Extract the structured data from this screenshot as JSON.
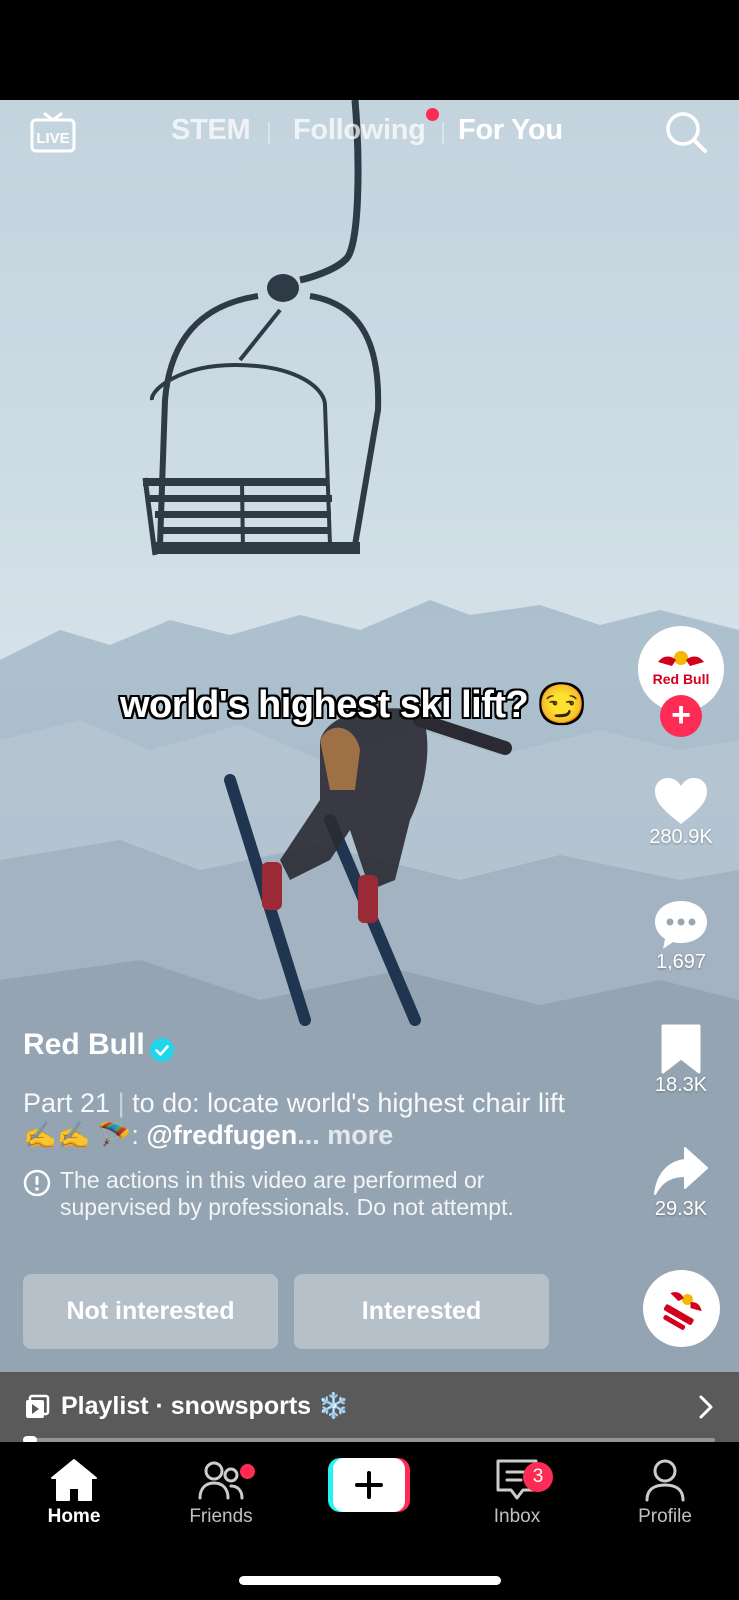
{
  "top_nav": {
    "live_label": "LIVE",
    "tabs": [
      {
        "label": "STEM",
        "active": false
      },
      {
        "label": "Following",
        "active": false,
        "has_dot": true
      },
      {
        "label": "For You",
        "active": true
      }
    ]
  },
  "video": {
    "caption": "world's highest ski lift? 😏"
  },
  "rail": {
    "avatar_brand": "Red Bull",
    "likes": "280.9K",
    "comments": "1,697",
    "saves": "18.3K",
    "shares": "29.3K"
  },
  "post": {
    "author": "Red Bull",
    "desc_part": "Part 21",
    "desc_text": "to do: locate world's highest chair lift ✍️✍️ 🪂:",
    "mention": "@fredfugen",
    "ellipsis": "...",
    "more": "more",
    "warning": "The actions in this video are performed or supervised by professionals. Do not attempt."
  },
  "buttons": {
    "not_interested": "Not interested",
    "interested": "Interested"
  },
  "playlist": {
    "label": "Playlist · snowsports ❄️",
    "progress": 0.02
  },
  "bottom_nav": {
    "items": [
      {
        "label": "Home",
        "active": true
      },
      {
        "label": "Friends",
        "has_dot": true
      },
      {
        "label": "Inbox",
        "badge": "3"
      },
      {
        "label": "Profile"
      }
    ]
  },
  "colors": {
    "accent": "#fe2c55",
    "cyan": "#25f4ee",
    "verified": "#20d5ec"
  }
}
